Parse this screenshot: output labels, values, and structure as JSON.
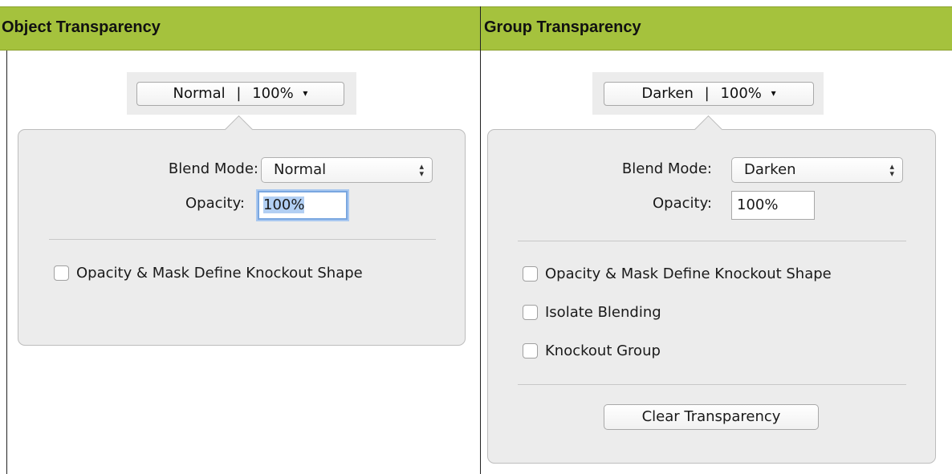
{
  "headers": {
    "left": "Object Transparency",
    "right": "Group Transparency"
  },
  "object_panel": {
    "trigger": {
      "mode": "Normal",
      "separator": "|",
      "opacity": "100%",
      "caret": "▾"
    },
    "blend_mode_label": "Blend Mode:",
    "blend_mode_value": "Normal",
    "opacity_label": "Opacity:",
    "opacity_value": "100%",
    "checkboxes": [
      {
        "label": "Opacity & Mask Define Knockout Shape",
        "checked": false
      }
    ]
  },
  "group_panel": {
    "trigger": {
      "mode": "Darken",
      "separator": "|",
      "opacity": "100%",
      "caret": "▾"
    },
    "blend_mode_label": "Blend Mode:",
    "blend_mode_value": "Darken",
    "opacity_label": "Opacity:",
    "opacity_value": "100%",
    "checkboxes": [
      {
        "label": "Opacity & Mask Define Knockout Shape",
        "checked": false
      },
      {
        "label": "Isolate Blending",
        "checked": false
      },
      {
        "label": "Knockout Group",
        "checked": false
      }
    ],
    "clear_button": "Clear Transparency"
  },
  "colors": {
    "header_bg": "#a5c23d",
    "popover_bg": "#ececec",
    "focus_ring": "#7aa7e0"
  },
  "icons": {
    "stepper": "updown-chevrons-icon",
    "caret": "caret-down-icon"
  }
}
